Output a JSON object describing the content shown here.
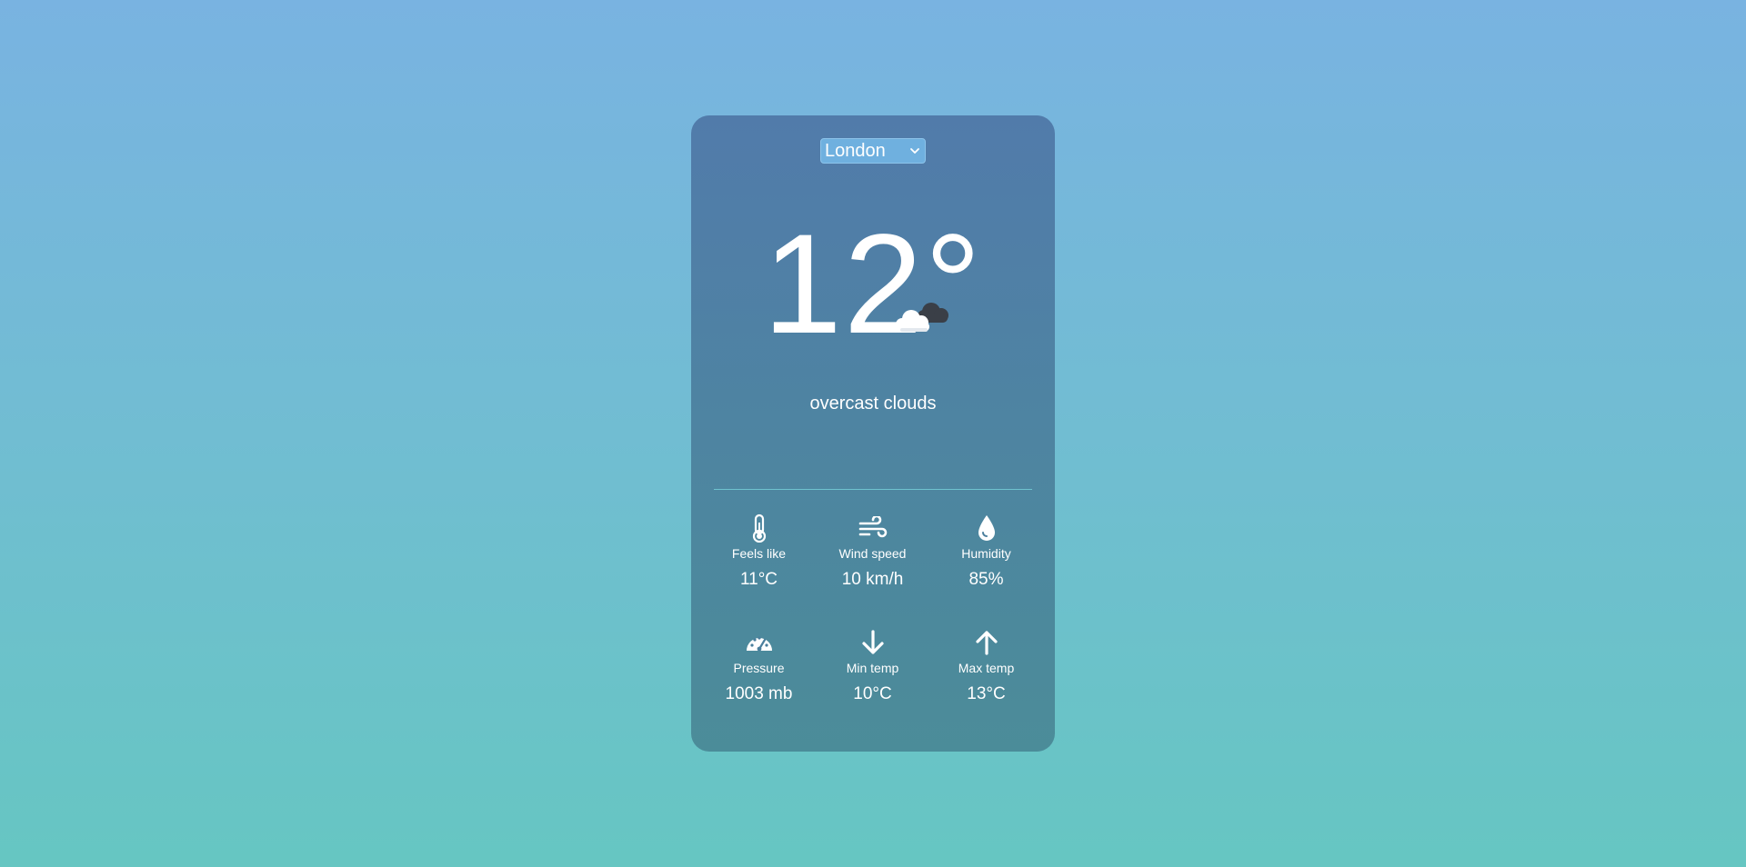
{
  "location": {
    "selected": "London",
    "icon": "chevron-down-icon"
  },
  "current": {
    "temperature": "12°",
    "description": "overcast clouds",
    "icon": "overcast-clouds-icon"
  },
  "stats": [
    {
      "icon": "thermometer-icon",
      "label": "Feels like",
      "value": "11°C"
    },
    {
      "icon": "wind-icon",
      "label": "Wind speed",
      "value": "10 km/h"
    },
    {
      "icon": "water-drop-icon",
      "label": "Humidity",
      "value": "85%"
    },
    {
      "icon": "gauge-icon",
      "label": "Pressure",
      "value": "1003 mb"
    },
    {
      "icon": "arrow-down-icon",
      "label": "Min temp",
      "value": "10°C"
    },
    {
      "icon": "arrow-up-icon",
      "label": "Max temp",
      "value": "13°C"
    }
  ],
  "colors": {
    "background_top": "#79b3e1",
    "background_bottom": "#66c6c2",
    "card": "#4e76a6",
    "select": "#6fb0df",
    "divider": "#6fc3d0"
  }
}
